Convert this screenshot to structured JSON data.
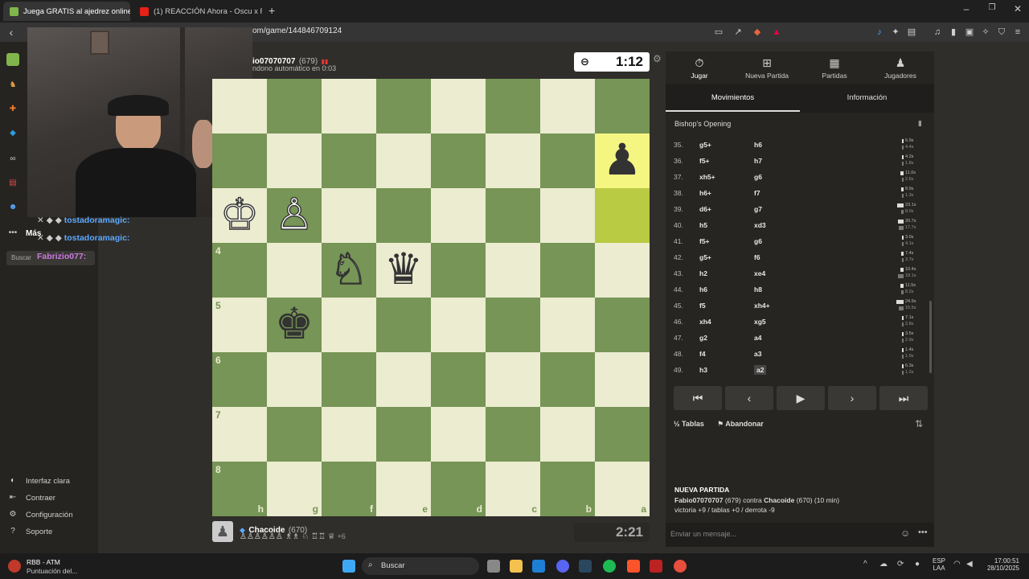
{
  "tabs": [
    {
      "label": "Juega GRATIS al ajedrez online -",
      "active": true
    },
    {
      "label": "(1) REACCIÓN Ahora - Oscu x Flexo",
      "active": false
    }
  ],
  "address": {
    "url": "om/game/144846709124"
  },
  "leftnav": {
    "more_label": "Más",
    "search_label": "Buscar",
    "footer": [
      {
        "label": "Interfaz clara",
        "icon": "moon-icon"
      },
      {
        "label": "Contraer",
        "icon": "collapse-icon"
      },
      {
        "label": "Configuración",
        "icon": "gear-icon"
      },
      {
        "label": "Soporte",
        "icon": "help-icon"
      }
    ]
  },
  "overlay_chat": [
    {
      "user": "tostadoramagic:"
    },
    {
      "user": "tostadoramagic:"
    },
    {
      "user": "Fabrizio077:"
    }
  ],
  "top_player": {
    "name": "io07070707",
    "rating": "(679)",
    "status": "ndono automático en 0:03",
    "clock": "1:12"
  },
  "bottom_player": {
    "name": "Chacoide",
    "rating": "(670)",
    "captured_extra": "+6",
    "clock": "2:21"
  },
  "board": {
    "ranks": [
      "",
      "",
      "",
      "4",
      "5",
      "6",
      "7",
      "8"
    ],
    "files": [
      "h",
      "g",
      "f",
      "e",
      "d",
      "c",
      "b",
      "a"
    ],
    "highlight": [
      [
        1,
        7
      ],
      [
        2,
        7
      ]
    ],
    "pieces": [
      {
        "r": 1,
        "c": 7,
        "glyph": "♟",
        "color": "black"
      },
      {
        "r": 2,
        "c": 0,
        "glyph": "♔",
        "color": "white"
      },
      {
        "r": 2,
        "c": 1,
        "glyph": "♙",
        "color": "white"
      },
      {
        "r": 3,
        "c": 2,
        "glyph": "♘",
        "color": "white"
      },
      {
        "r": 3,
        "c": 3,
        "glyph": "♛",
        "color": "black"
      },
      {
        "r": 4,
        "c": 1,
        "glyph": "♚",
        "color": "black"
      }
    ]
  },
  "rpanel": {
    "tabs": [
      {
        "label": "Jugar",
        "icon": "stopwatch-icon"
      },
      {
        "label": "Nueva Partida",
        "icon": "plus-icon"
      },
      {
        "label": "Partidas",
        "icon": "board-icon"
      },
      {
        "label": "Jugadores",
        "icon": "players-icon"
      }
    ],
    "subtabs": [
      "Movimientos",
      "Información"
    ],
    "opening": "Bishop's Opening",
    "moves": [
      {
        "n": "35.",
        "w": "g5+",
        "b": "h6",
        "tw": "6.9s",
        "tb": "4.4s",
        "ww": 0.08,
        "wb": 0.05
      },
      {
        "n": "36.",
        "w": "f5+",
        "b": "h7",
        "tw": "4.2s",
        "tb": "1.8s",
        "ww": 0.05,
        "wb": 0.02
      },
      {
        "n": "37.",
        "w": "xh5+",
        "b": "g6",
        "tw": "11.0s",
        "tb": "2.6s",
        "ww": 0.13,
        "wb": 0.03
      },
      {
        "n": "38.",
        "w": "h6+",
        "b": "f7",
        "tw": "8.9s",
        "tb": "1.3s",
        "ww": 0.1,
        "wb": 0.02
      },
      {
        "n": "39.",
        "w": "d6+",
        "b": "g7",
        "tw": "23.1s",
        "tb": "8.0s",
        "ww": 0.28,
        "wb": 0.1
      },
      {
        "n": "40.",
        "w": "h5",
        "b": "xd3",
        "tw": "20.7s",
        "tb": "17.7s",
        "ww": 0.25,
        "wb": 0.21
      },
      {
        "n": "41.",
        "w": "f5+",
        "b": "g6",
        "tw": "3.0s",
        "tb": "4.1s",
        "ww": 0.04,
        "wb": 0.05
      },
      {
        "n": "42.",
        "w": "g5+",
        "b": "f6",
        "tw": "7.4s",
        "tb": "3.7s",
        "ww": 0.09,
        "wb": 0.04
      },
      {
        "n": "43.",
        "w": "h2",
        "b": "xe4",
        "tw": "10.4s",
        "tb": "18.1s",
        "ww": 0.12,
        "wb": 0.22
      },
      {
        "n": "44.",
        "w": "h6",
        "b": "h8",
        "tw": "11.5s",
        "tb": "8.2s",
        "ww": 0.14,
        "wb": 0.1
      },
      {
        "n": "45.",
        "w": "f5",
        "b": "xh4+",
        "tw": "24.9s",
        "tb": "15.5s",
        "ww": 0.3,
        "wb": 0.19
      },
      {
        "n": "46.",
        "w": "xh4",
        "b": "xg5",
        "tw": "7.1s",
        "tb": "2.8s",
        "ww": 0.08,
        "wb": 0.03
      },
      {
        "n": "47.",
        "w": "g2",
        "b": "a4",
        "tw": "3.5s",
        "tb": "2.9s",
        "ww": 0.04,
        "wb": 0.03
      },
      {
        "n": "48.",
        "w": "f4",
        "b": "a3",
        "tw": "1.4s",
        "tb": "1.9s",
        "ww": 0.02,
        "wb": 0.02
      },
      {
        "n": "49.",
        "w": "h3",
        "b": "a2",
        "tw": "6.3s",
        "tb": "1.2s",
        "ww": 0.07,
        "wb": 0.01
      }
    ],
    "draw_label": "Tablas",
    "resign_label": "Abandonar",
    "draw_icon": "½",
    "new_game": {
      "title": "NUEVA PARTIDA",
      "p1": "Fabio07070707",
      "p1_rating": "(679)",
      "vs": "contra",
      "p2": "Chacoide",
      "p2_rating": "(670) (10 min)",
      "record": "victoria +9 / tablas +0 / derrota -9"
    },
    "chat_placeholder": "Enviar un mensaje..."
  },
  "taskbar": {
    "notif_title": "RBB - ATM",
    "notif_sub": "Puntuación del...",
    "search_label": "Buscar",
    "lang": "ESP",
    "lang_sub": "LAA",
    "time": "17:00:51",
    "date": "28/10/2025"
  },
  "colors": {
    "board_light": "#ebecd0",
    "board_dark": "#779556",
    "highlight": "#f5f682"
  }
}
